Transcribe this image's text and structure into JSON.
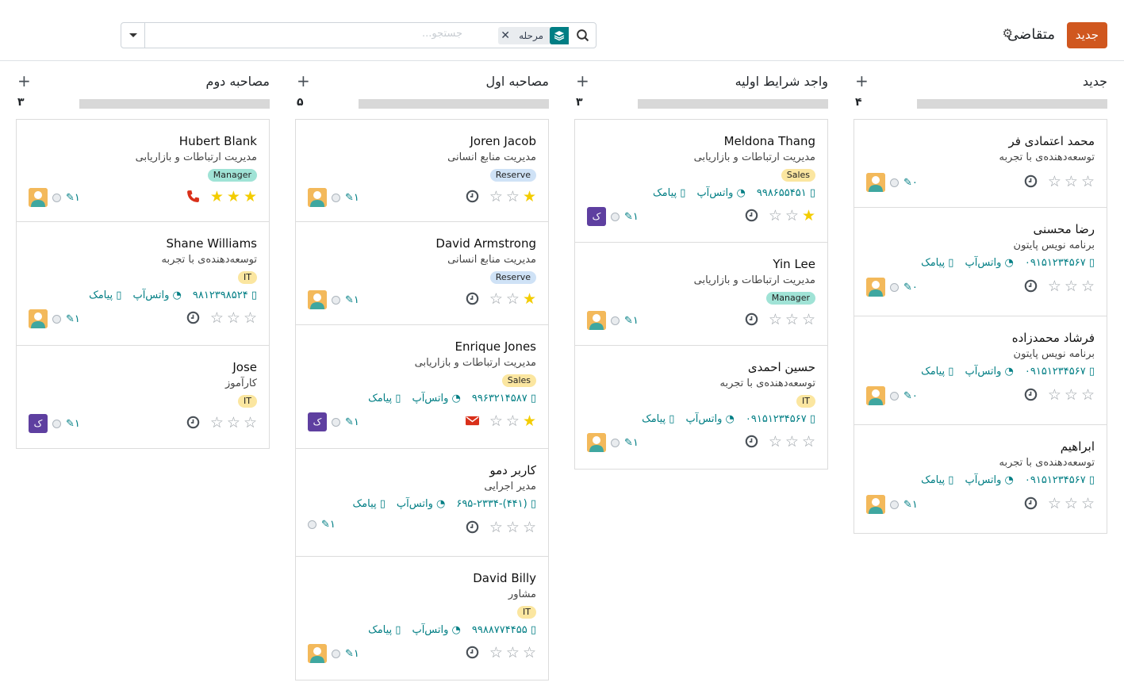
{
  "control_panel": {
    "new_button": "جدید",
    "title": "متقاضی",
    "search": {
      "facet_label": "مرحله",
      "placeholder": "جستجو..."
    }
  },
  "columns": [
    {
      "title": "جدید",
      "count": "۴",
      "cards": [
        {
          "name": "محمد اعتمادی فر",
          "job": "توسعه‌دهنده‌ی با تجربه",
          "tag": "",
          "phone": "",
          "stars": 0,
          "activity": "clock",
          "avatar": "face",
          "attach": "۰"
        },
        {
          "name": "رضا محسنی",
          "job": "برنامه نویس پایتون",
          "tag": "",
          "phone": "۰۹۱۵۱۲۳۴۵۶۷",
          "stars": 0,
          "activity": "clock",
          "avatar": "face",
          "attach": "۰"
        },
        {
          "name": "فرشاد محمدزاده",
          "job": "برنامه نویس پایتون",
          "tag": "",
          "phone": "۰۹۱۵۱۲۳۴۵۶۷",
          "stars": 0,
          "activity": "clock",
          "avatar": "face",
          "attach": "۰"
        },
        {
          "name": "ابراهیم",
          "job": "توسعه‌دهنده‌ی با تجربه",
          "tag": "",
          "phone": "۰۹۱۵۱۲۳۴۵۶۷",
          "stars": 0,
          "activity": "clock",
          "avatar": "face",
          "attach": "۱"
        }
      ]
    },
    {
      "title": "واجد شرایط اولیه",
      "count": "۳",
      "cards": [
        {
          "name": "Meldona Thang",
          "job": "مدیریت ارتباطات و بازاریابی",
          "tag": "Sales",
          "phone": "۹۹۸۶۵۵۴۵۱",
          "stars": 1,
          "activity": "clock",
          "avatar": "k",
          "attach": "۱"
        },
        {
          "name": "Yin Lee",
          "job": "مدیریت ارتباطات و بازاریابی",
          "tag": "Manager",
          "phone": "",
          "stars": 0,
          "activity": "clock",
          "avatar": "face",
          "attach": "۱"
        },
        {
          "name": "حسین احمدی",
          "job": "توسعه‌دهنده‌ی با تجربه",
          "tag": "IT",
          "phone": "۰۹۱۵۱۲۳۴۵۶۷",
          "stars": 0,
          "activity": "clock",
          "avatar": "face",
          "attach": "۱"
        }
      ]
    },
    {
      "title": "مصاحبه اول",
      "count": "۵",
      "cards": [
        {
          "name": "Joren Jacob",
          "job": "مدیریت منابع انسانی",
          "tag": "Reserve",
          "phone": "",
          "stars": 1,
          "activity": "clock",
          "avatar": "face",
          "attach": "۱"
        },
        {
          "name": "David Armstrong",
          "job": "مدیریت منابع انسانی",
          "tag": "Reserve",
          "phone": "",
          "stars": 1,
          "activity": "clock",
          "avatar": "face",
          "attach": "۱"
        },
        {
          "name": "Enrique Jones",
          "job": "مدیریت ارتباطات و بازاریابی",
          "tag": "Sales",
          "phone": "۹۹۶۳۲۱۴۵۸۷",
          "stars": 1,
          "activity": "mail",
          "avatar": "k",
          "attach": "۱"
        },
        {
          "name": "کاربر دمو",
          "job": "مدیر اجرایی",
          "tag": "",
          "phone": "(۴۴۱)-۶۹۵-۲۳۳۴",
          "stars": 0,
          "activity": "clock",
          "avatar": "none",
          "attach": "۱"
        },
        {
          "name": "David Billy",
          "job": "مشاور",
          "tag": "IT",
          "phone": "۹۹۸۸۷۷۴۴۵۵",
          "stars": 0,
          "activity": "clock",
          "avatar": "face",
          "attach": "۱"
        }
      ]
    },
    {
      "title": "مصاحبه دوم",
      "count": "۳",
      "cards": [
        {
          "name": "Hubert Blank",
          "job": "مدیریت ارتباطات و بازاریابی",
          "tag": "Manager",
          "phone": "",
          "stars": 3,
          "activity": "phone",
          "avatar": "face",
          "attach": "۱"
        },
        {
          "name": "Shane Williams",
          "job": "توسعه‌دهنده‌ی با تجربه",
          "tag": "IT",
          "phone": "۹۸۱۲۳۹۸۵۲۴",
          "stars": 0,
          "activity": "clock",
          "avatar": "face",
          "attach": "۱"
        },
        {
          "name": "Jose",
          "job": "کارآموز",
          "tag": "IT",
          "phone": "",
          "stars": 0,
          "activity": "clock",
          "avatar": "k",
          "attach": "۱"
        }
      ]
    }
  ],
  "contact_labels": {
    "whatsapp": "واتس‌آپ",
    "sms": "پیامک"
  },
  "avatar_initial": "ک",
  "tag_colors": {
    "Sales": "#fbe6a0",
    "Manager": "#a0e3d6",
    "Reserve": "#cfe2f6",
    "IT": "#fbe6a0"
  },
  "colors": {
    "accent": "#017e84",
    "primary_button": "#d0571f",
    "star_on": "#f3cc00"
  }
}
